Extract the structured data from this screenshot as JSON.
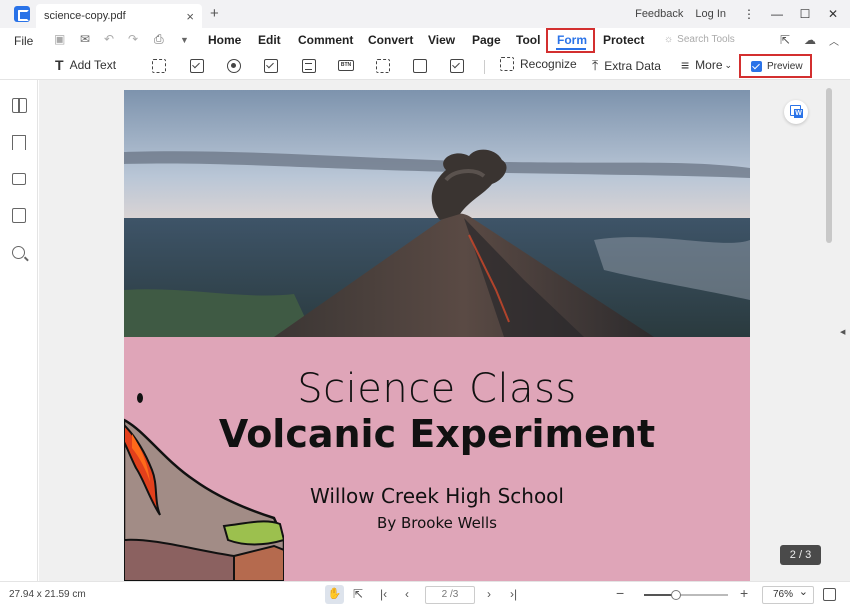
{
  "titlebar": {
    "tab_title": "science-copy.pdf",
    "tab_close": "×",
    "new_tab": "+",
    "feedback": "Feedback",
    "login": "Log In",
    "more_dots": "⋮",
    "minimize": "—",
    "maximize": "☐",
    "close": "✕"
  },
  "menubar": {
    "file": "File",
    "items": [
      "Home",
      "Edit",
      "Comment",
      "Convert",
      "View",
      "Page",
      "Tool",
      "Form",
      "Protect"
    ],
    "search_placeholder": "Search Tools"
  },
  "toolbar": {
    "add_text": "Add Text",
    "recognize": "Recognize",
    "extra_data": "Extra Data",
    "more": "More",
    "preview": "Preview",
    "btn_icon_text": "BTN"
  },
  "document": {
    "title_line1": "Science Class",
    "title_line2": "Volcanic Experiment",
    "school": "Willow Creek High School",
    "author": "By Brooke Wells"
  },
  "page_badge": "2 / 3",
  "statusbar": {
    "dimensions": "27.94 x 21.59 cm",
    "page_field": "2 /3",
    "zoom": "76%",
    "zoom_level": 0.38
  },
  "colors": {
    "accent": "#2a73e8",
    "highlight_box": "#d32f2f",
    "page_pink": "#dfa5b8"
  }
}
